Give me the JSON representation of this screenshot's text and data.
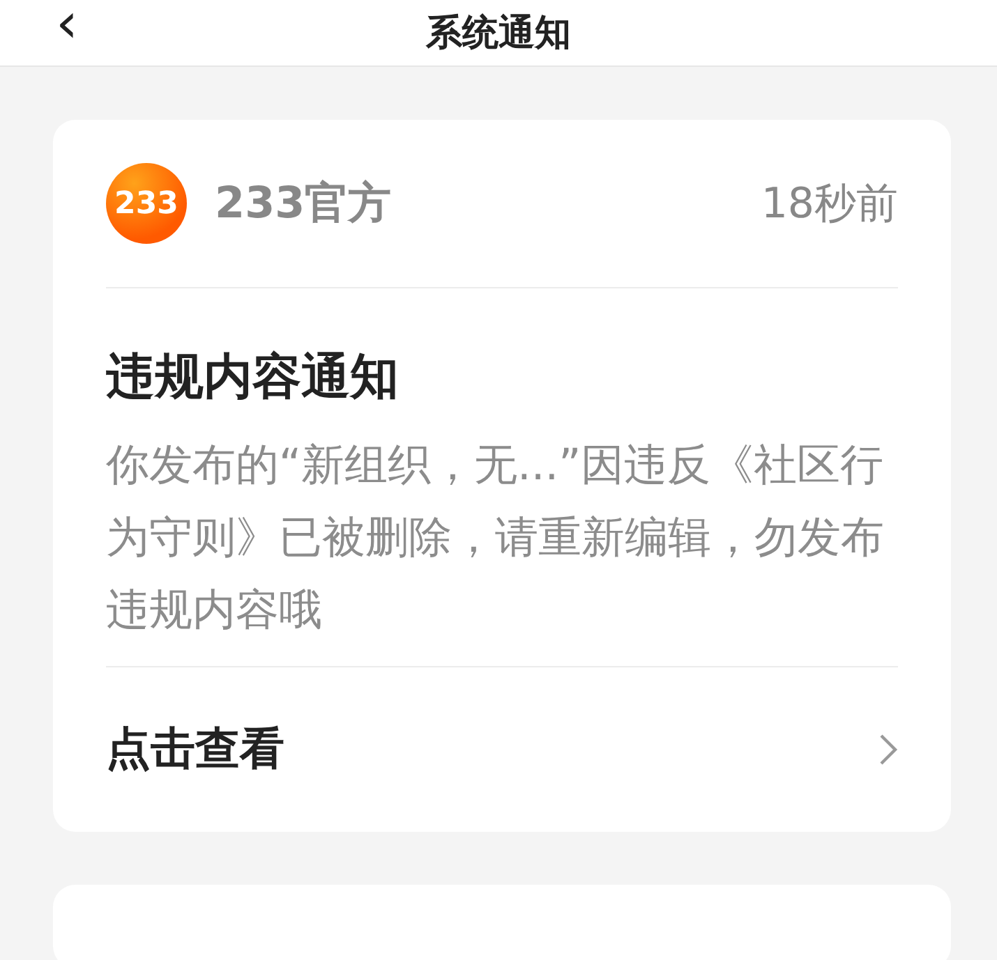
{
  "header": {
    "back": "‹",
    "title": "系统通知"
  },
  "notifications": [
    {
      "logo_text": "233",
      "sender": "233官方",
      "time": "18秒前",
      "title": "违规内容通知",
      "body": "你发布的“新组织，无...”因违反《社区行为守则》已被删除，请重新编辑，勿发布违规内容哦",
      "action": "点击查看"
    }
  ]
}
